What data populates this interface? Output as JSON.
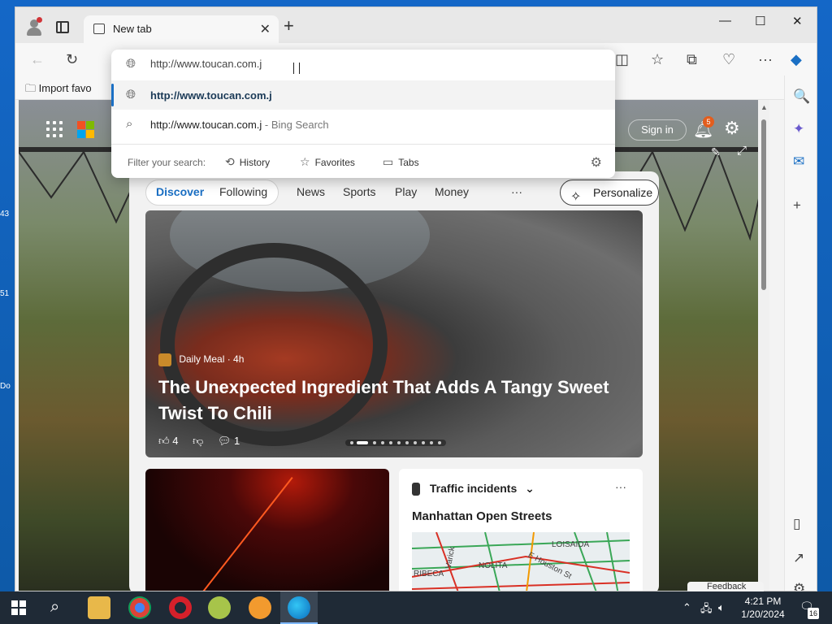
{
  "desktop": {
    "labels": [
      "43",
      "51",
      "Do"
    ]
  },
  "window": {
    "tab_title": "New tab",
    "close_tab": "✕",
    "new_tab": "+",
    "minimize": "—",
    "maximize": "☐",
    "close": "✕"
  },
  "favorites_bar": {
    "import_label": "Import favo"
  },
  "omnibox": {
    "value": "http://www.toucan.com.j",
    "suggestions": [
      {
        "text": "http://www.toucan.com.j",
        "suffix": ""
      },
      {
        "text": "http://www.toucan.com.j",
        "suffix": " - Bing Search"
      }
    ],
    "filter_label": "Filter your search:",
    "filters": [
      "History",
      "Favorites",
      "Tabs"
    ]
  },
  "ntp": {
    "sign_in": "Sign in",
    "notification_count": "5",
    "nav": [
      "Discover",
      "Following",
      "News",
      "Sports",
      "Play",
      "Money",
      "···"
    ],
    "personalize": "Personalize",
    "hero": {
      "source": "Daily Meal · 4h",
      "headline": "The Unexpected Ingredient That Adds A Tangy Sweet Twist To Chili",
      "likes": "4",
      "comments": "1"
    },
    "traffic": {
      "title": "Traffic incidents",
      "more": "···",
      "subtitle": "Manhattan Open Streets",
      "map_labels": [
        "LOISAIDA",
        "Varick",
        "NOLITA",
        "E Houston St",
        "RIBECA"
      ]
    },
    "feedback": "Feedback"
  },
  "taskbar": {
    "time": "4:21 PM",
    "date": "1/20/2024",
    "notifications": "16"
  },
  "colors": {
    "accent": "#1a6fc4",
    "taskbar": "#1f2a36",
    "badge": "#e35d1d"
  }
}
